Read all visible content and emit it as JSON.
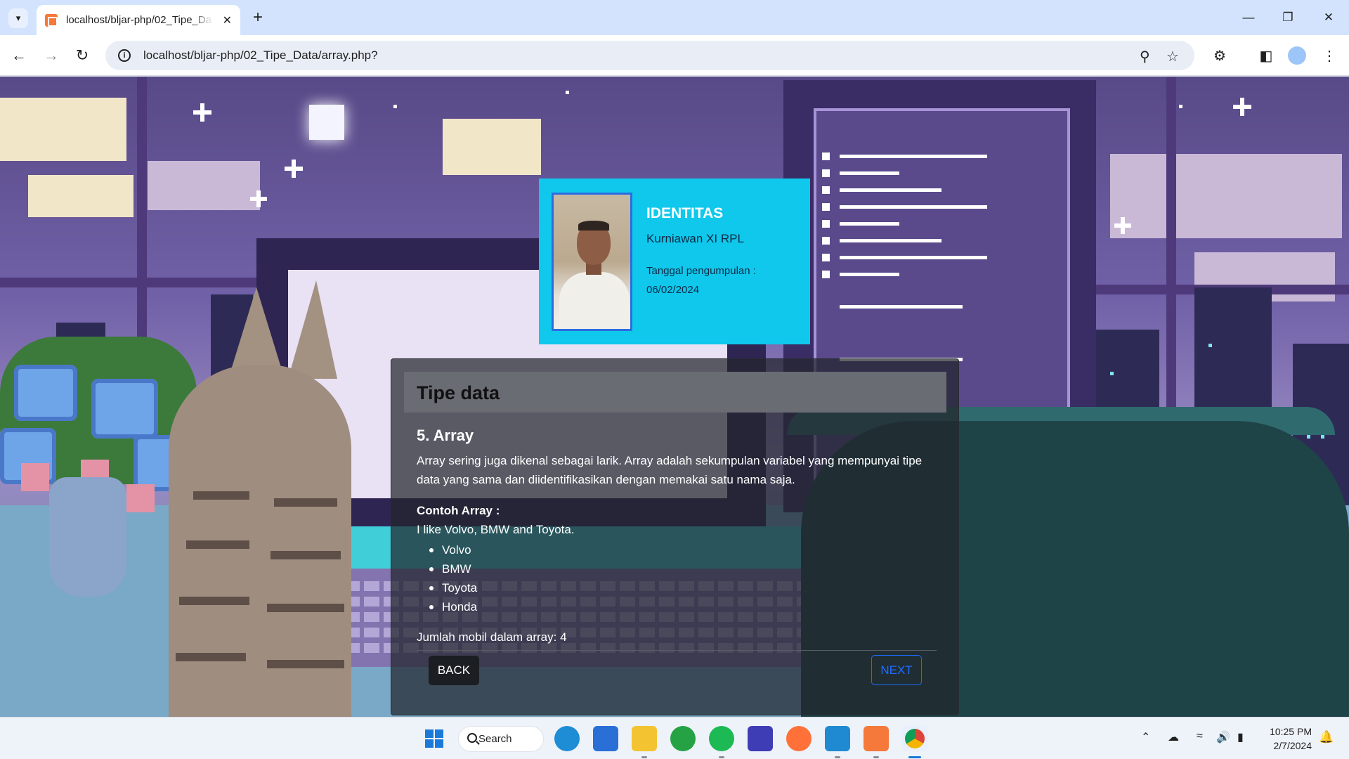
{
  "browser": {
    "tab_title": "localhost/bljar-php/02_Tipe_Da",
    "url": "localhost/bljar-php/02_Tipe_Data/array.php?"
  },
  "identity": {
    "heading": "IDENTITAS",
    "name": "Kurniawan XI RPL",
    "date_label": "Tanggal pengumpulan :",
    "date": "06/02/2024"
  },
  "panel": {
    "title": "Tipe data",
    "section_title": "5. Array",
    "description": "Array sering juga dikenal sebagai larik. Array adalah sekumpulan variabel yang mempunyai tipe data yang sama dan diidentifikasikan dengan memakai satu nama saja.",
    "example_title": "Contoh Array :",
    "example_text": "I like Volvo, BMW and Toyota.",
    "cars": [
      "Volvo",
      "BMW",
      "Toyota",
      "Honda"
    ],
    "count_text": "Jumlah mobil dalam array: 4",
    "back_label": "BACK",
    "next_label": "NEXT"
  },
  "taskbar": {
    "search_label": "Search",
    "time": "10:25 PM",
    "date": "2/7/2024",
    "apps": [
      "start-icon",
      "edge-icon",
      "store-icon",
      "file-explorer-icon",
      "whatsapp-icon",
      "spotify-icon",
      "zoom-icon",
      "firefox-icon",
      "vscode-icon",
      "xampp-icon",
      "chrome-icon"
    ]
  },
  "colors": {
    "id_card": "#0fc8ec",
    "panel_bg": "#21252d",
    "header_bg": "#6a6c74",
    "next_button": "#1f6bff",
    "tab_bar": "#d3e3fd"
  }
}
